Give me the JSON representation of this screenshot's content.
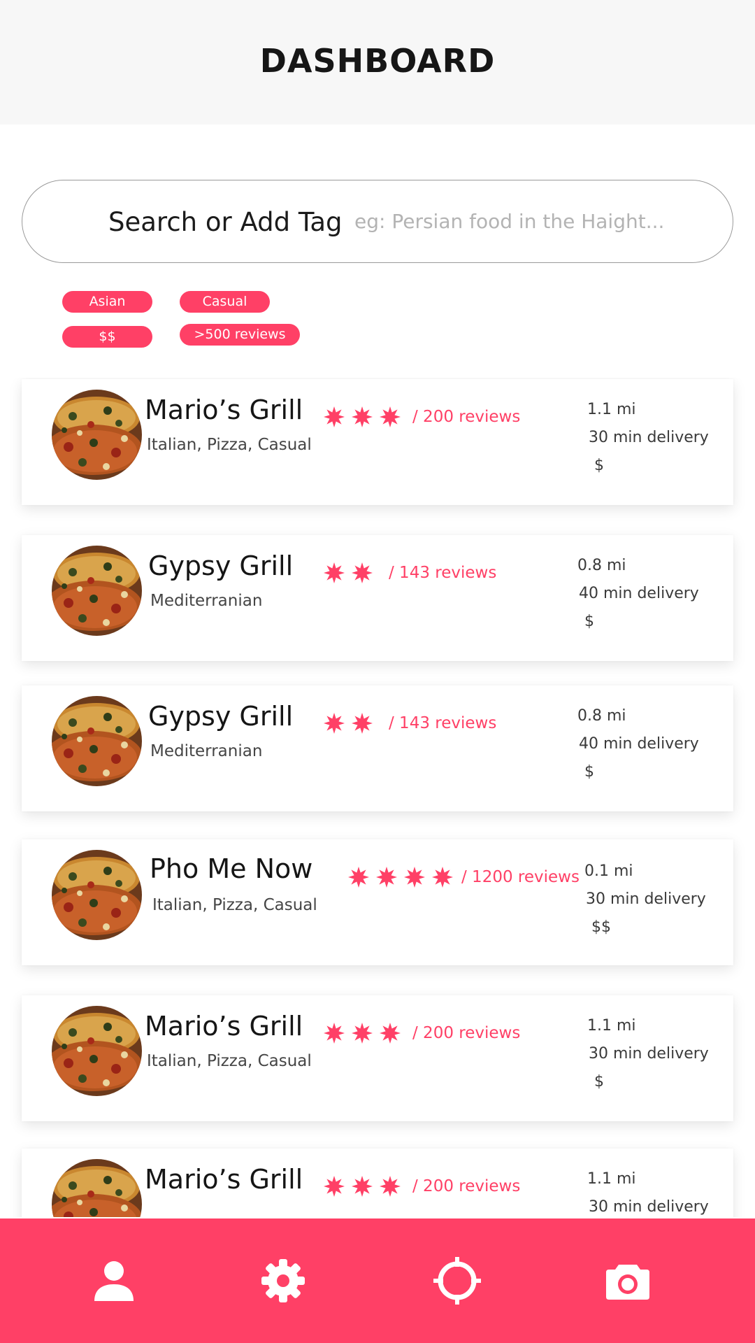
{
  "header": {
    "title": "DASHBOARD"
  },
  "search": {
    "label": "Search or Add Tag",
    "placeholder": "eg: Persian food in the Haight...",
    "value": ""
  },
  "tags": [
    "Asian",
    "Casual",
    "$$",
    ">500 reviews"
  ],
  "restaurants": [
    {
      "name": "Mario’s Grill",
      "stars": 3,
      "reviews": "/ 200 reviews",
      "cuisine": "Italian, Pizza, Casual",
      "distance": "1.1 mi",
      "delivery": "30 min delivery",
      "price": "$"
    },
    {
      "name": "Gypsy Grill",
      "stars": 2,
      "reviews": "/ 143 reviews",
      "cuisine": "Mediterranian",
      "distance": "0.8 mi",
      "delivery": "40 min delivery",
      "price": "$"
    },
    {
      "name": "Gypsy Grill",
      "stars": 2,
      "reviews": "/ 143 reviews",
      "cuisine": "Mediterranian",
      "distance": "0.8 mi",
      "delivery": "40 min delivery",
      "price": "$"
    },
    {
      "name": "Pho Me Now",
      "stars": 4,
      "reviews": "/ 1200 reviews",
      "cuisine": "Italian, Pizza, Casual",
      "distance": "0.1 mi",
      "delivery": "30 min delivery",
      "price": "$$"
    },
    {
      "name": "Mario’s Grill",
      "stars": 3,
      "reviews": "/ 200 reviews",
      "cuisine": "Italian, Pizza, Casual",
      "distance": "1.1 mi",
      "delivery": "30 min delivery",
      "price": "$"
    },
    {
      "name": "Mario’s Grill",
      "stars": 3,
      "reviews": "/ 200 reviews",
      "cuisine": "",
      "distance": "1.1 mi",
      "delivery": "30 min delivery",
      "price": ""
    }
  ],
  "nav": {
    "icons": [
      "user-icon",
      "gear-icon",
      "crosshair-icon",
      "camera-icon"
    ]
  },
  "colors": {
    "accent": "#ff4066",
    "header_bg": "#f7f7f7"
  }
}
